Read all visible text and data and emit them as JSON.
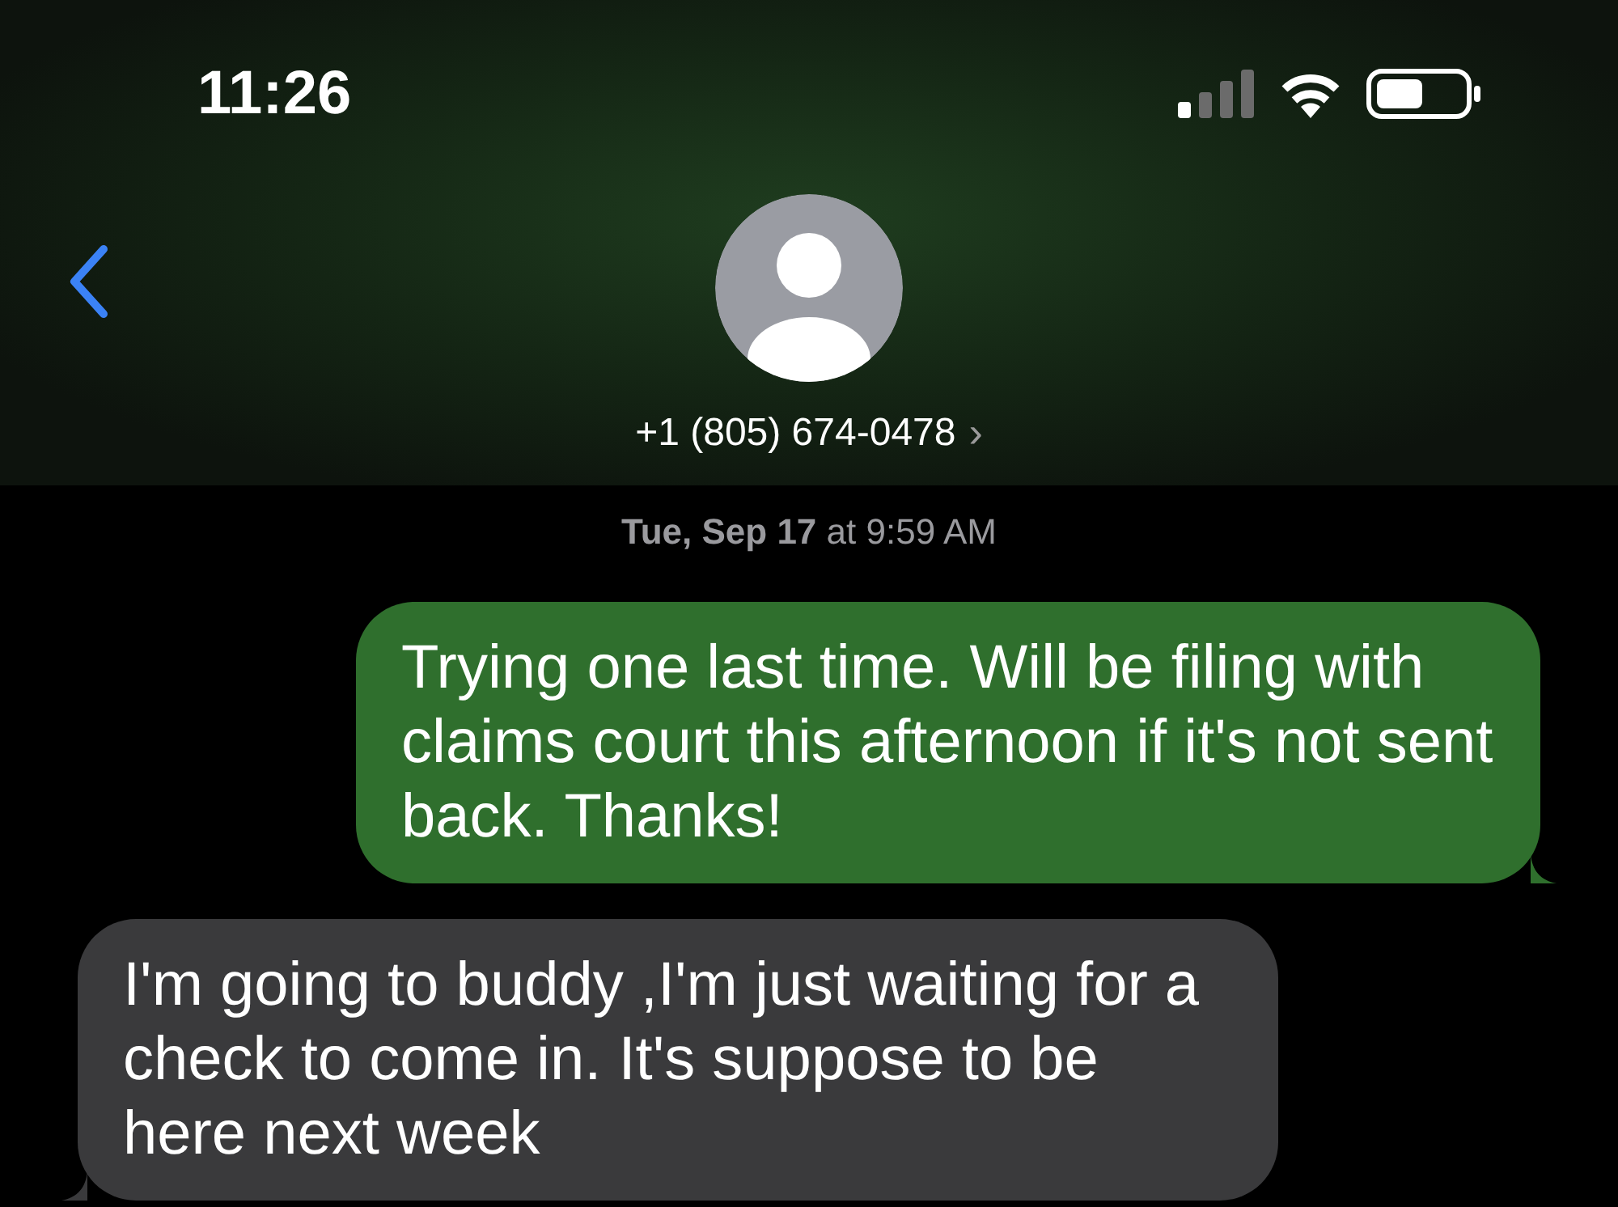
{
  "status_bar": {
    "time": "11:26"
  },
  "header": {
    "contact": "+1 (805) 674-0478",
    "contact_chevron": "›"
  },
  "timestamp": "**Tue, Sep 17** at 9:59 AM",
  "messages": [
    {
      "kind": "outgoing",
      "text": "Trying one last time. Will be filing with claims court this afternoon if it's not sent back. Thanks!"
    },
    {
      "kind": "incoming",
      "text": "I'm going to buddy ,I'm just waiting for a check to come in. It's suppose to be here next week"
    }
  ]
}
